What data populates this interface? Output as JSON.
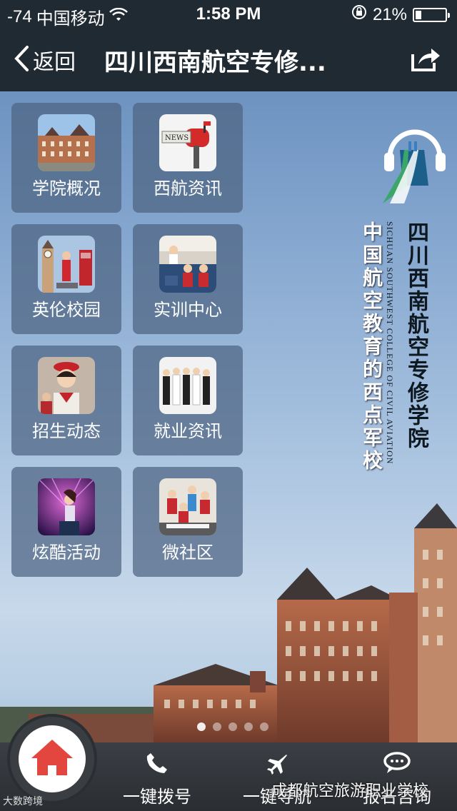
{
  "status_bar": {
    "signal": "-74",
    "carrier": "中国移动",
    "time": "1:58 PM",
    "battery": "21%",
    "battery_level": 0.21
  },
  "nav": {
    "back_label": "返回",
    "title": "四川西南航空专修..."
  },
  "tiles": [
    {
      "label": "学院概况",
      "icon": "campus-building-photo"
    },
    {
      "label": "西航资讯",
      "icon": "news-mailbox-photo"
    },
    {
      "label": "英伦校园",
      "icon": "british-campus-photo"
    },
    {
      "label": "实训中心",
      "icon": "training-center-photo"
    },
    {
      "label": "招生动态",
      "icon": "flight-attendant-photo"
    },
    {
      "label": "就业资讯",
      "icon": "graduates-group-photo"
    },
    {
      "label": "炫酷活动",
      "icon": "stage-performance-photo"
    },
    {
      "label": "微社区",
      "icon": "community-group-photo"
    }
  ],
  "logo": {
    "school_name": "四川西南航空专修学院",
    "english_name": "SICHUAN SOUTHWEST COLLEGE OF CIVIL AVIATION",
    "slogan": "中国航空教育的西点军校"
  },
  "bottom_bar": {
    "items": [
      {
        "label": "一键拨号",
        "icon": "phone-icon"
      },
      {
        "label": "一键导航",
        "icon": "airplane-icon"
      },
      {
        "label": "报名咨询",
        "icon": "chat-bubble-icon"
      }
    ]
  },
  "watermark": {
    "right": "成都航空旅游职业学校",
    "left": "大数跨境"
  },
  "colors": {
    "bar": "#1f2a33",
    "tile": "#4e6482",
    "home_red": "#e2463e"
  }
}
